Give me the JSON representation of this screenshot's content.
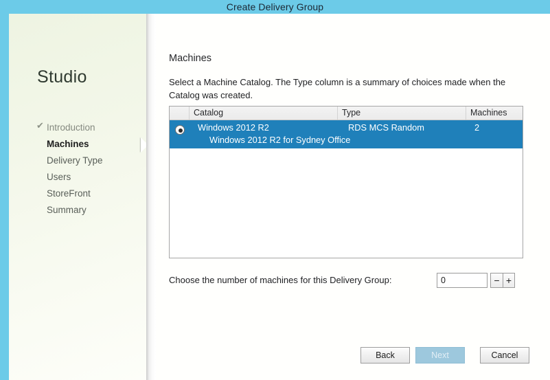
{
  "window": {
    "title": "Create Delivery Group",
    "title_bar_color": "#6ccbe8"
  },
  "sidebar": {
    "product_title": "Studio",
    "check_glyph": "✔",
    "items": [
      {
        "label": "Introduction",
        "state": "done"
      },
      {
        "label": "Machines",
        "state": "current"
      },
      {
        "label": "Delivery Type",
        "state": "pending"
      },
      {
        "label": "Users",
        "state": "pending"
      },
      {
        "label": "StoreFront",
        "state": "pending"
      },
      {
        "label": "Summary",
        "state": "pending"
      }
    ]
  },
  "content": {
    "page_title": "Machines",
    "description": "Select a Machine Catalog. The Type column is a summary of choices made when the Catalog was created.",
    "table": {
      "columns": [
        "",
        "Catalog",
        "Type",
        "Machines"
      ],
      "rows": [
        {
          "selected": true,
          "catalog": "Windows 2012 R2",
          "catalog_description": "Windows 2012 R2 for Sydney Office",
          "type": "RDS MCS Random",
          "machines": "2"
        }
      ]
    },
    "spinner": {
      "label": "Choose the number of machines for this Delivery Group:",
      "value": "0",
      "decrement_label": "−",
      "increment_label": "+"
    }
  },
  "footer": {
    "back_label": "Back",
    "next_label": "Next",
    "cancel_label": "Cancel",
    "next_enabled": false
  }
}
